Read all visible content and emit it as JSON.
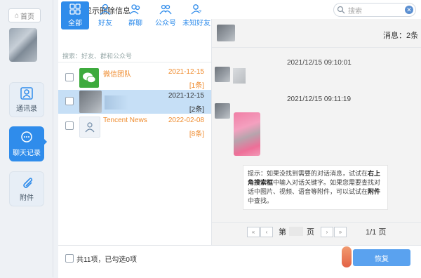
{
  "rail": {
    "home_label": "首页",
    "items": [
      {
        "label": "通讯录",
        "icon": "contacts-icon"
      },
      {
        "label": "聊天记录",
        "icon": "chat-bubble-icon"
      },
      {
        "label": "附件",
        "icon": "paperclip-icon"
      }
    ]
  },
  "topbar": {
    "show_deleted_label": "只显示删除信息",
    "search_placeholder": "搜索"
  },
  "tabs": [
    {
      "label": "全部",
      "icon": "grid-icon"
    },
    {
      "label": "好友",
      "icon": "person-icon"
    },
    {
      "label": "群聊",
      "icon": "group-icon"
    },
    {
      "label": "公众号",
      "icon": "official-account-icon"
    },
    {
      "label": "未知好友",
      "icon": "unknown-friend-icon"
    }
  ],
  "list_search_placeholder": "搜索：好友、群和公众号",
  "conversations": [
    {
      "name": "微信团队",
      "date": "2021-12-15",
      "count": "[1条]"
    },
    {
      "name": "",
      "date": "2021-12-15",
      "count": "[2条]"
    },
    {
      "name": "Tencent News",
      "date": "2022-02-08",
      "count": "[8条]"
    }
  ],
  "chat": {
    "message_count": "消息：2条",
    "timestamps": [
      "2021/12/15 09:10:01",
      "2021/12/15 09:11:19"
    ],
    "tip": {
      "p1": "提示：如果没找到需要的对话消息，试试在",
      "b1": "右上角搜索框",
      "p2": "中输入对话关键字。如果您需要查找对话中图片、视频、语音等附件，可以试试在",
      "b2": "附件",
      "p3": "中查找。"
    },
    "pager": {
      "first": "«",
      "prev": "‹",
      "next": "›",
      "last": "»",
      "page_prefix": "第",
      "page_suffix": "页",
      "page_status": "1/1 页"
    }
  },
  "footer": {
    "selection_summary": "共11项，已勾选0项",
    "restore_label": "恢复"
  },
  "colors": {
    "accent": "#2f8ceb",
    "orange": "#ef8a2b",
    "selected_row": "#c6dff6"
  }
}
